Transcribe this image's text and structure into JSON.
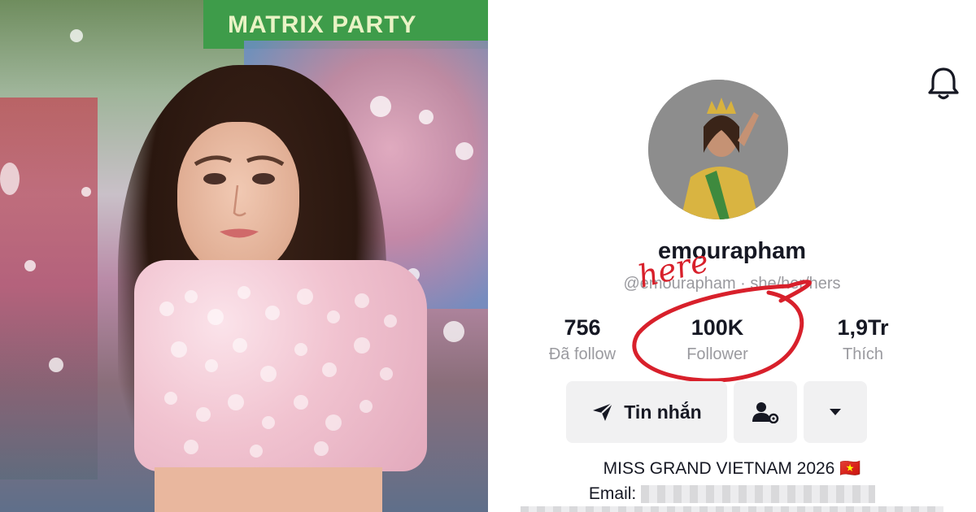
{
  "photo": {
    "banner_text": "MATRIX PARTY"
  },
  "profile": {
    "username": "emourapham",
    "handle": "@emourapham · she/her/hers",
    "stats": [
      {
        "value": "756",
        "label": "Đã follow"
      },
      {
        "value": "100K",
        "label": "Follower"
      },
      {
        "value": "1,9Tr",
        "label": "Thích"
      }
    ],
    "annotation_text": "here",
    "message_button_label": "Tin nhắn",
    "bio": {
      "line1": "MISS GRAND VIETNAM 2026 🇻🇳",
      "email_label": "Email:"
    },
    "icons": {
      "bell": "bell-icon",
      "send": "send-icon",
      "add_user": "add-user-icon",
      "dropdown": "caret-down-icon"
    },
    "colors": {
      "annotation": "#d8202b",
      "button_bg": "#f1f1f2",
      "text_secondary": "#9a9a9f"
    }
  }
}
